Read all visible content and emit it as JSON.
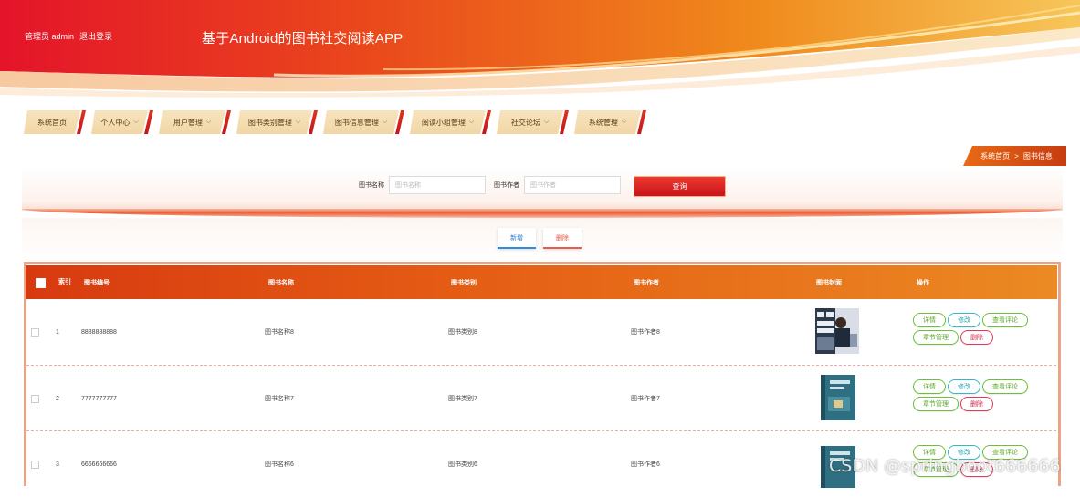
{
  "header": {
    "user_role": "管理员 admin",
    "logout": "退出登录",
    "app_title": "基于Android的图书社交阅读APP"
  },
  "nav": [
    {
      "label": "系统首页",
      "has_dropdown": false
    },
    {
      "label": "个人中心",
      "has_dropdown": true
    },
    {
      "label": "用户管理",
      "has_dropdown": true
    },
    {
      "label": "图书类别管理",
      "has_dropdown": true
    },
    {
      "label": "图书信息管理",
      "has_dropdown": true
    },
    {
      "label": "阅读小组管理",
      "has_dropdown": true
    },
    {
      "label": "社交论坛",
      "has_dropdown": true
    },
    {
      "label": "系统管理",
      "has_dropdown": true
    }
  ],
  "breadcrumb": {
    "home": "系统首页",
    "separator": ">",
    "current": "图书信息"
  },
  "search": {
    "name_label": "图书名称",
    "name_placeholder": "图书名称",
    "author_label": "图书作者",
    "author_placeholder": "图书作者",
    "button": "查询"
  },
  "actions": {
    "add": "新增",
    "delete": "删除"
  },
  "table": {
    "headers": {
      "index": "索引",
      "code": "图书编号",
      "name": "图书名称",
      "category": "图书类别",
      "author": "图书作者",
      "cover": "图书封面",
      "ops": "操作"
    },
    "rows": [
      {
        "index": "1",
        "code": "8888888888",
        "name": "图书名称8",
        "category": "图书类别8",
        "author": "图书作者8",
        "cover_style": "photo"
      },
      {
        "index": "2",
        "code": "7777777777",
        "name": "图书名称7",
        "category": "图书类别7",
        "author": "图书作者7",
        "cover_style": "teal"
      },
      {
        "index": "3",
        "code": "6666666666",
        "name": "图书名称6",
        "category": "图书类别6",
        "author": "图书作者6",
        "cover_style": "teal"
      }
    ],
    "op_labels": {
      "detail": "详情",
      "edit": "修改",
      "review": "查看评论",
      "chapter": "章节管理",
      "delete": "删除"
    }
  },
  "watermark": "CSDN @springboot666666",
  "colors": {
    "primary_red": "#c8101a",
    "header_orange": "#e8761a",
    "nav_tab": "#f4dcb0"
  }
}
